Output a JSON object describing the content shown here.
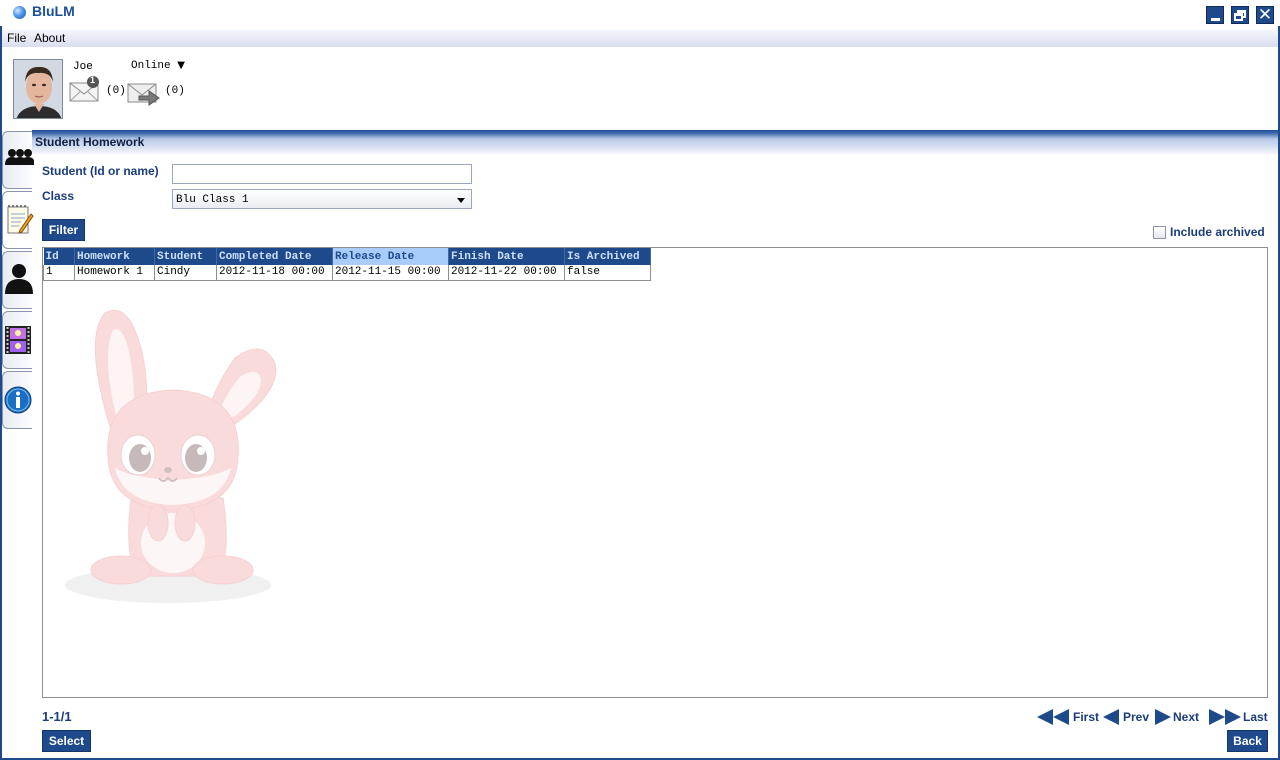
{
  "window": {
    "title": "BluLM"
  },
  "menu": {
    "file": "File",
    "about": "About"
  },
  "user": {
    "name": "Joe",
    "status": "Online",
    "status_arrow": "▼",
    "messages_badge": "1",
    "messages_count": "(0)",
    "forwarded_count": "(0)"
  },
  "sidebar": {
    "items": [
      {
        "icon": "people-icon"
      },
      {
        "icon": "notepad-icon"
      },
      {
        "icon": "person-icon"
      },
      {
        "icon": "film-icon"
      },
      {
        "icon": "info-icon"
      }
    ]
  },
  "section": {
    "title": "Student Homework"
  },
  "form": {
    "student_label": "Student (Id or name)",
    "student_value": "",
    "class_label": "Class",
    "class_value": "Blu Class 1",
    "filter_button": "Filter",
    "include_archived_label": "Include archived",
    "include_archived_checked": false
  },
  "grid": {
    "columns": [
      "Id",
      "Homework",
      "Student",
      "Completed Date",
      "Release Date",
      "Finish Date",
      "Is Archived"
    ],
    "selected_column": "Release Date",
    "rows": [
      [
        "1",
        "Homework 1",
        "Cindy",
        "2012-11-18 00:00",
        "2012-11-15 00:00",
        "2012-11-22 00:00",
        "false"
      ]
    ]
  },
  "pager": {
    "info": "1-1/1",
    "first": "First",
    "prev": "Prev",
    "next": "Next",
    "last": "Last"
  },
  "footer": {
    "select_button": "Select",
    "back_button": "Back"
  },
  "colors": {
    "accent": "#1e4a8c",
    "label": "#1b3d7a",
    "selected_header": "#a8cdfb"
  }
}
